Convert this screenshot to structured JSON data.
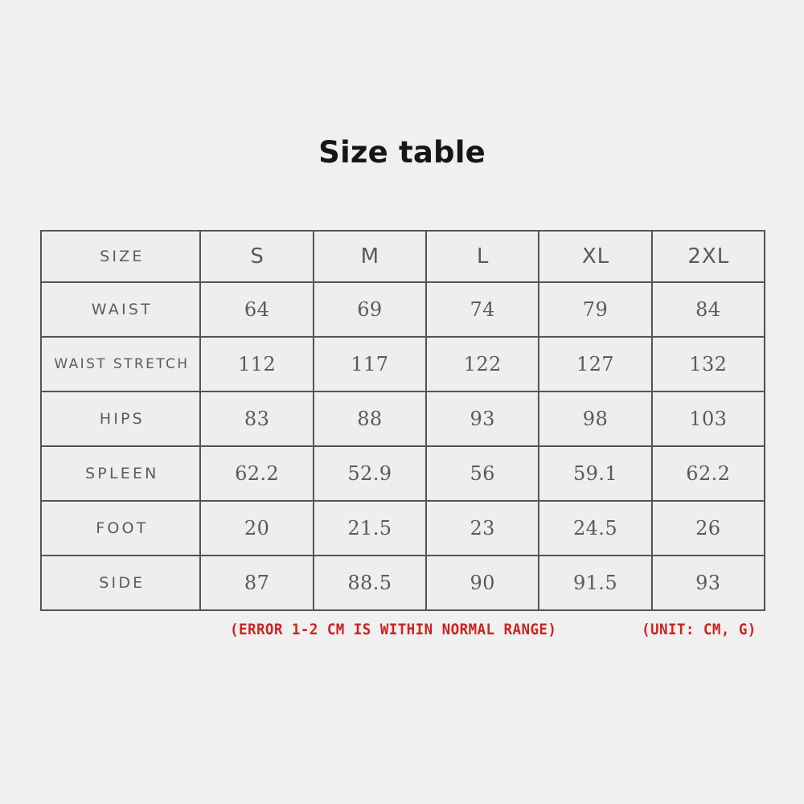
{
  "title": "Size table",
  "table": {
    "columns": [
      "SIZE",
      "S",
      "M",
      "L",
      "XL",
      "2XL"
    ],
    "rows": [
      {
        "label": "WAIST",
        "values": [
          "64",
          "69",
          "74",
          "79",
          "84"
        ]
      },
      {
        "label": "WAIST STRETCH",
        "values": [
          "112",
          "117",
          "122",
          "127",
          "132"
        ]
      },
      {
        "label": "HIPS",
        "values": [
          "83",
          "88",
          "93",
          "98",
          "103"
        ]
      },
      {
        "label": "SPLEEN",
        "values": [
          "62.2",
          "52.9",
          "56",
          "59.1",
          "62.2"
        ]
      },
      {
        "label": "FOOT",
        "values": [
          "20",
          "21.5",
          "23",
          "24.5",
          "26"
        ]
      },
      {
        "label": "SIDE",
        "values": [
          "87",
          "88.5",
          "90",
          "91.5",
          "93"
        ]
      }
    ]
  },
  "footnotes": {
    "error_note": "(ERROR 1-2 CM IS WITHIN NORMAL RANGE)",
    "unit_note": "(UNIT: CM, G)"
  },
  "colors": {
    "page_background": "#f0f0f0",
    "cell_background": "#eeeeee",
    "border": "#545454",
    "title_text": "#161616",
    "cell_text": "#5a5a5a",
    "note_text": "#cc2222"
  }
}
